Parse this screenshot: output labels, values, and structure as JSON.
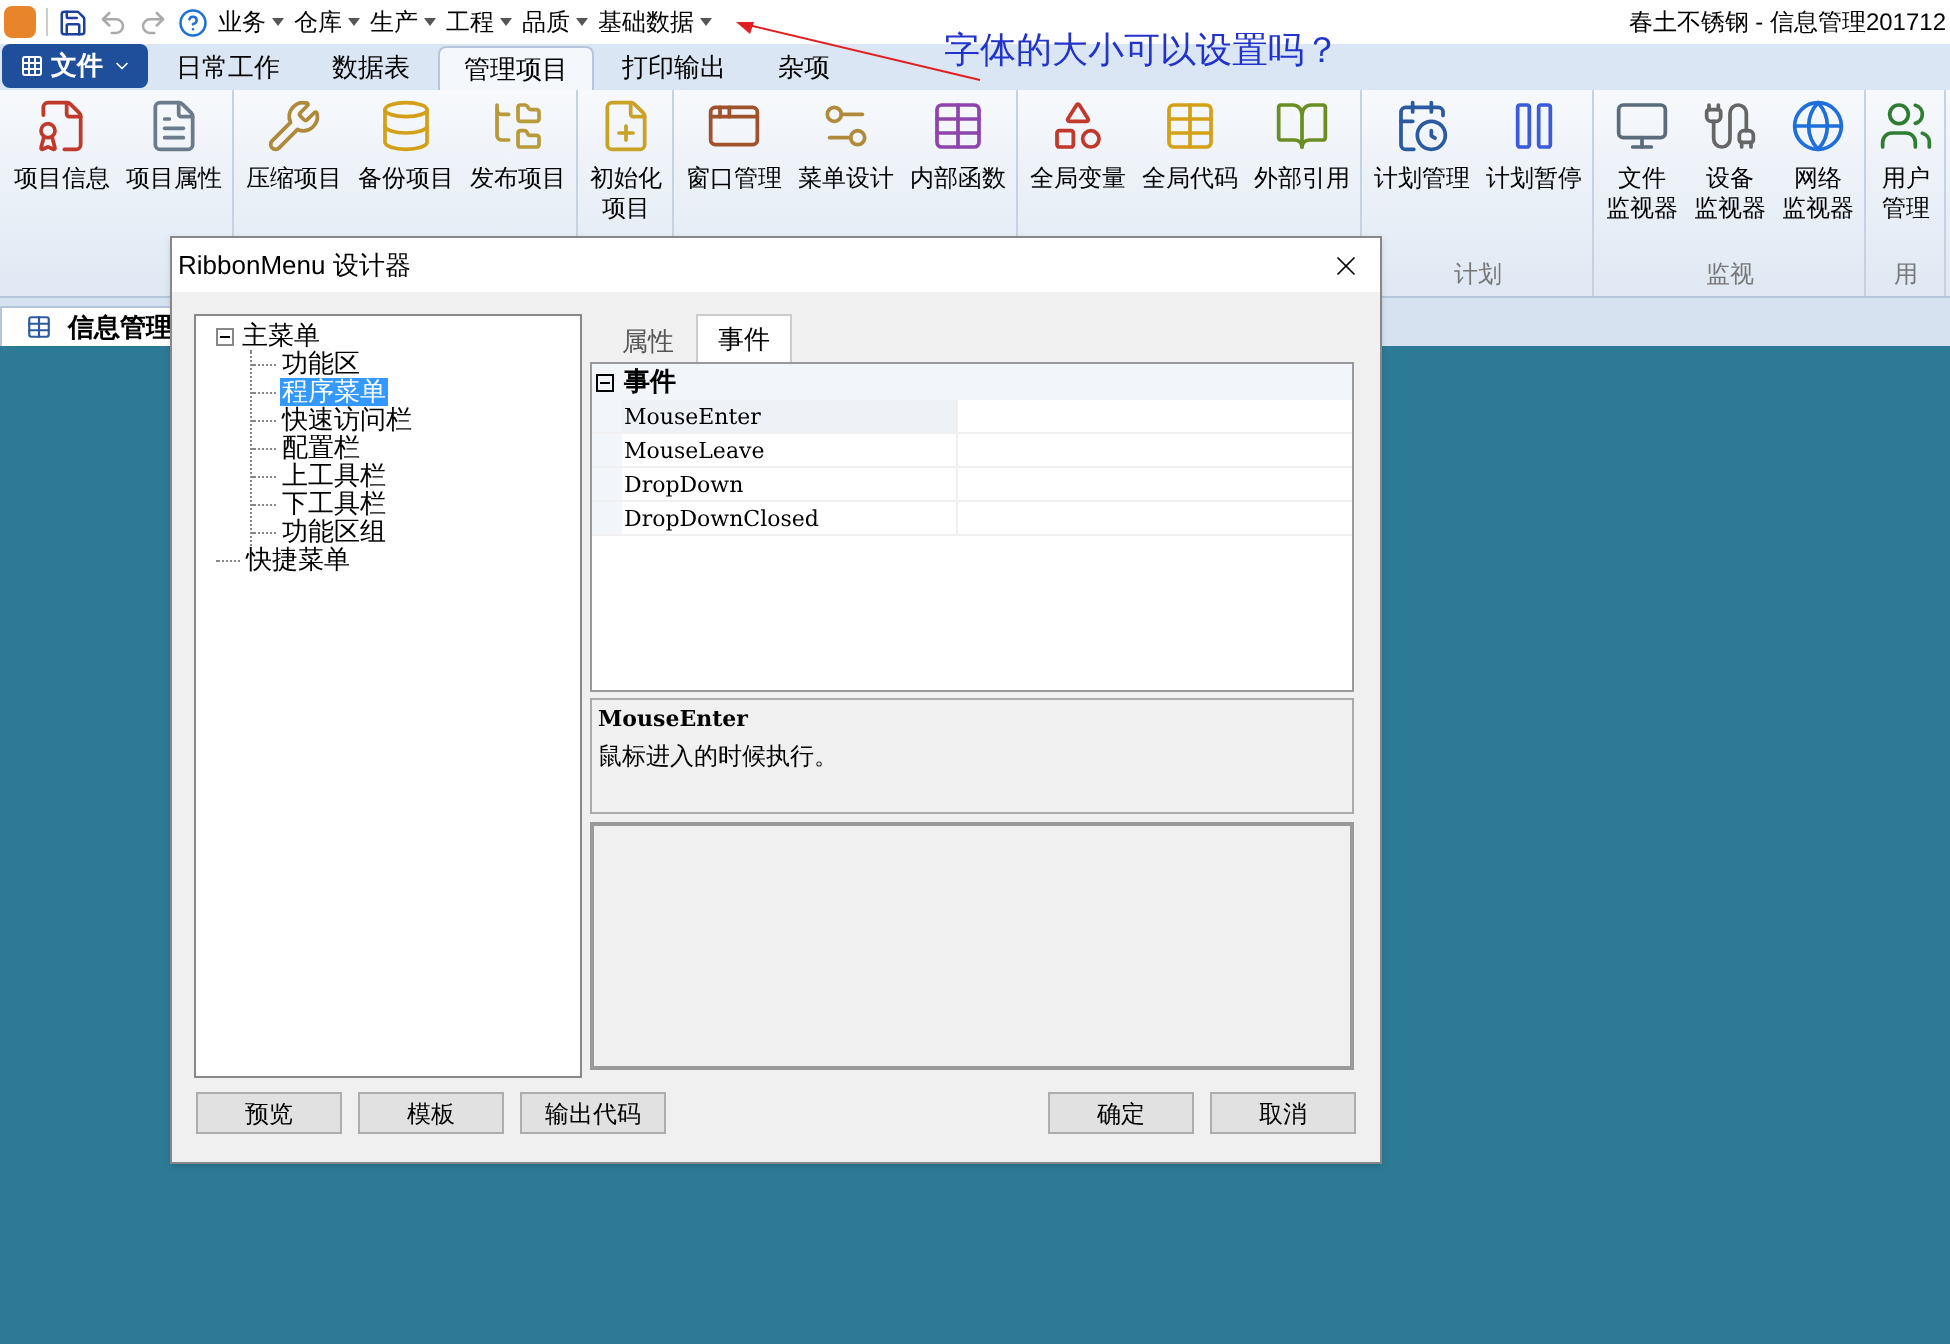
{
  "quick_access": {
    "menus": [
      "业务",
      "仓库",
      "生产",
      "工程",
      "品质",
      "基础数据"
    ]
  },
  "window_title": "春土不锈钢 - 信息管理201712",
  "annotation": {
    "text": "字体的大小可以设置吗？"
  },
  "file_button": "文件",
  "tabs": [
    {
      "label": "日常工作",
      "selected": false
    },
    {
      "label": "数据表",
      "selected": false
    },
    {
      "label": "管理项目",
      "selected": true
    },
    {
      "label": "打印输出",
      "selected": false
    },
    {
      "label": "杂项",
      "selected": false
    }
  ],
  "ribbon": {
    "groups": [
      {
        "items": [
          "项目信息",
          "项目属性"
        ]
      },
      {
        "items": [
          "压缩项目",
          "备份项目",
          "发布项目"
        ]
      },
      {
        "items": [
          [
            "初始化",
            "项目"
          ]
        ]
      },
      {
        "items": [
          "窗口管理",
          "菜单设计",
          "内部函数"
        ]
      },
      {
        "items": [
          "全局变量",
          "全局代码",
          "外部引用"
        ]
      },
      {
        "label": "计划",
        "items": [
          "计划管理",
          "计划暂停"
        ]
      },
      {
        "label": "监视",
        "items": [
          [
            "文件",
            "监视器"
          ],
          [
            "设备",
            "监视器"
          ],
          [
            "网络",
            "监视器"
          ]
        ]
      },
      {
        "label": "用",
        "items": [
          [
            "用户",
            "管理"
          ]
        ]
      }
    ]
  },
  "document_tab": "信息管理",
  "dialog": {
    "title": "RibbonMenu 设计器",
    "tree": [
      {
        "label": "主菜单",
        "expanded": true,
        "selected": false,
        "children": [
          {
            "label": "功能区",
            "selected": false
          },
          {
            "label": "程序菜单",
            "selected": true
          },
          {
            "label": "快速访问栏",
            "selected": false
          },
          {
            "label": "配置栏",
            "selected": false
          },
          {
            "label": "上工具栏",
            "selected": false
          },
          {
            "label": "下工具栏",
            "selected": false
          },
          {
            "label": "功能区组",
            "selected": false
          }
        ]
      },
      {
        "label": "快捷菜单",
        "selected": false
      }
    ],
    "tabs": [
      {
        "label": "属性",
        "selected": false
      },
      {
        "label": "事件",
        "selected": true
      }
    ],
    "grid": {
      "category": "事件",
      "rows": [
        {
          "name": "MouseEnter",
          "selected": true
        },
        {
          "name": "MouseLeave",
          "selected": false
        },
        {
          "name": "DropDown",
          "selected": false
        },
        {
          "name": "DropDownClosed",
          "selected": false
        }
      ]
    },
    "description": {
      "title": "MouseEnter",
      "text": "鼠标进入的时候执行。"
    },
    "left_buttons": [
      "预览",
      "模板",
      "输出代码"
    ],
    "right_buttons": [
      "确定",
      "取消"
    ]
  }
}
